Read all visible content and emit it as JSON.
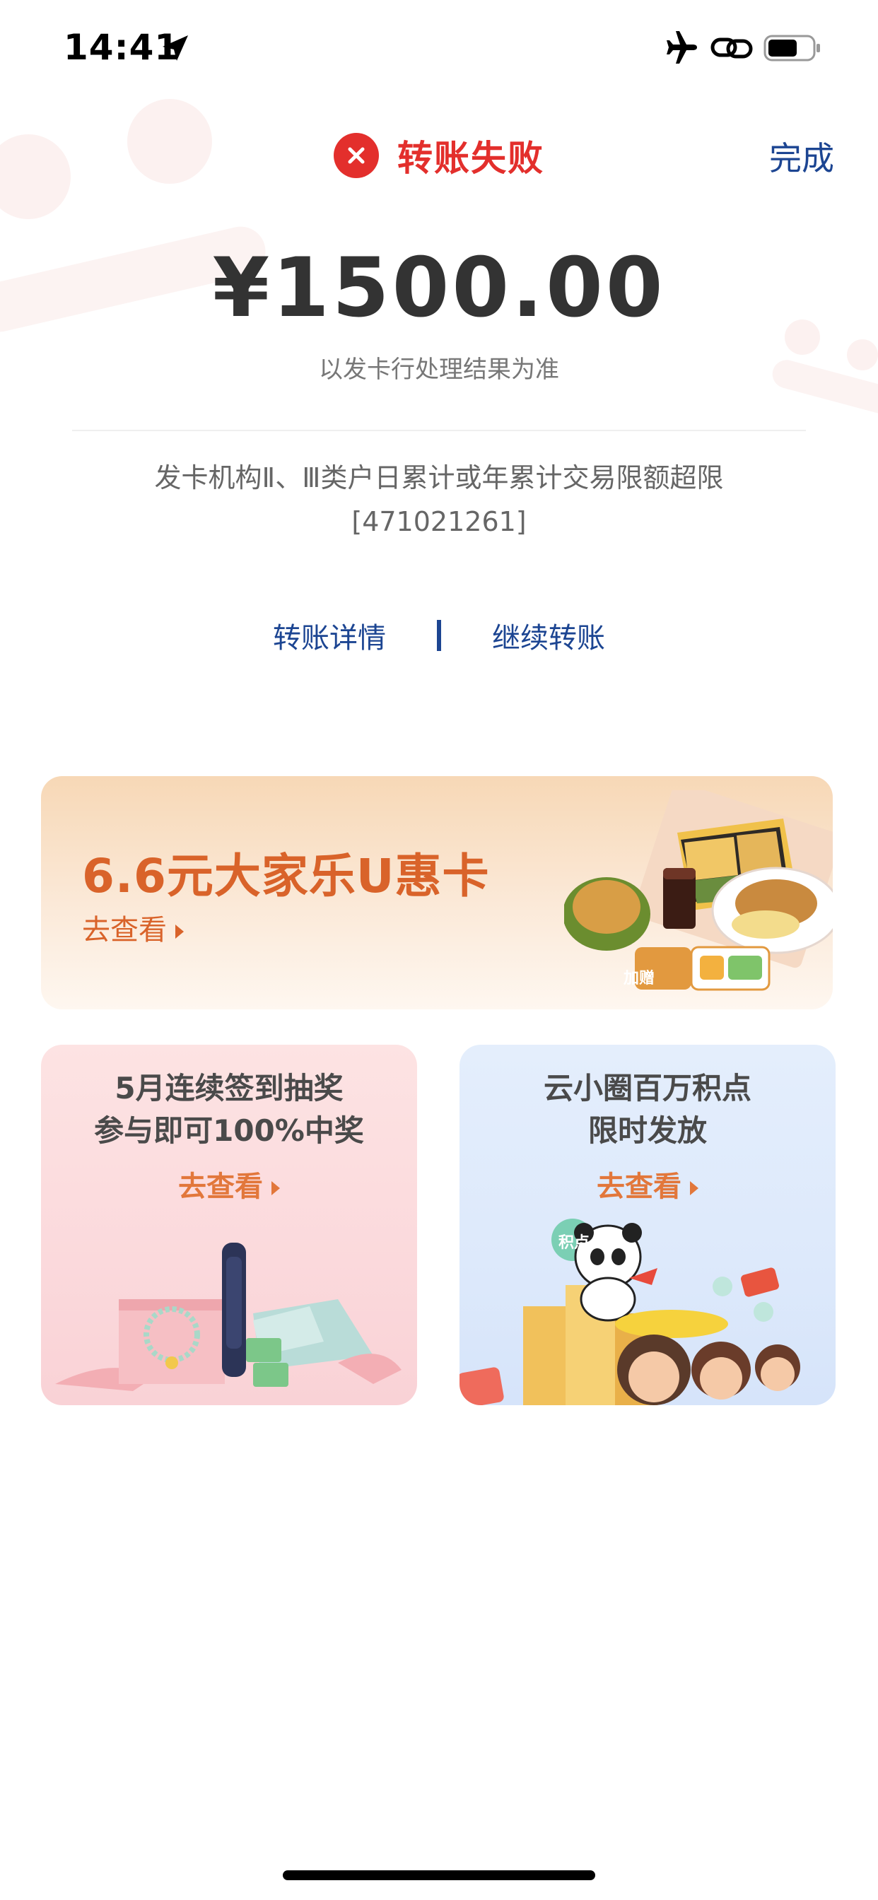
{
  "status_bar": {
    "time": "14:41"
  },
  "header": {
    "title": "转账失败",
    "done_label": "完成"
  },
  "result": {
    "amount": "¥1500.00",
    "note": "以发卡行处理结果为准",
    "error_message": "发卡机构Ⅱ、Ⅲ类户日累计或年累计交易限额超限[471021261]"
  },
  "links": {
    "details": "转账详情",
    "continue": "继续转账"
  },
  "banner": {
    "title": "6.6元大家乐U惠卡",
    "cta": "去查看",
    "badge": "加赠"
  },
  "cards": [
    {
      "title_line1": "5月连续签到抽奖",
      "title_line2": "参与即可100%中奖",
      "cta": "去查看"
    },
    {
      "title_line1": "云小圈百万积点",
      "title_line2": "限时发放",
      "cta": "去查看",
      "badge": "积点"
    }
  ],
  "colors": {
    "error_red": "#e32f2c",
    "link_blue": "#1c4592",
    "promo_orange": "#d9632a"
  }
}
